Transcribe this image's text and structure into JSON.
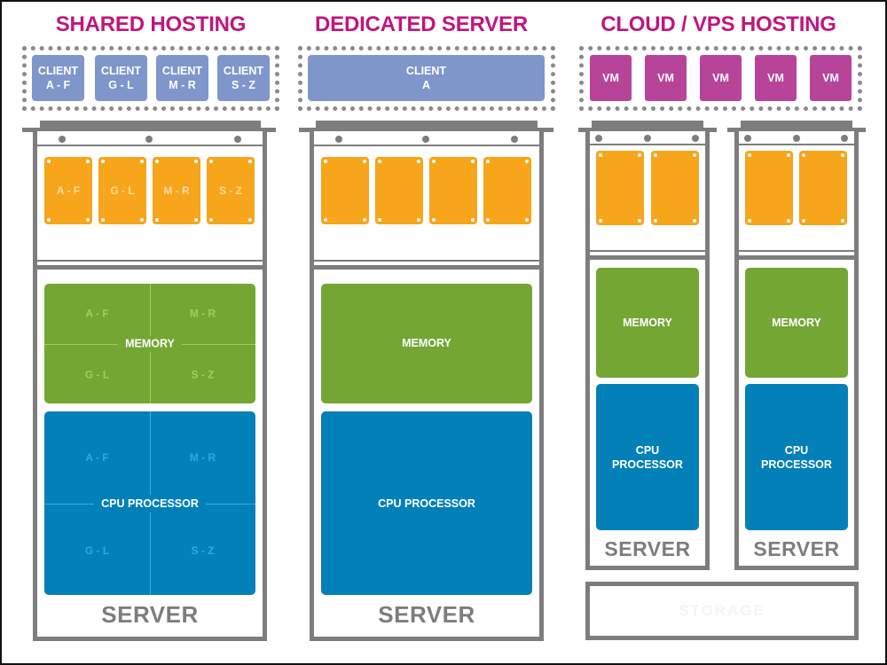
{
  "colors": {
    "title": "#c0157f",
    "client": "#7f96cb",
    "vm": "#b8449a",
    "drive": "#f7a51b",
    "memory": "#74a634",
    "cpu": "#0480b9",
    "chassis": "#7d7d7d"
  },
  "shared": {
    "title": "SHARED HOSTING",
    "clients": [
      {
        "line1": "CLIENT",
        "line2": "A - F"
      },
      {
        "line1": "CLIENT",
        "line2": "G - L"
      },
      {
        "line1": "CLIENT",
        "line2": "M - R"
      },
      {
        "line1": "CLIENT",
        "line2": "S - Z"
      }
    ],
    "drives": [
      "A - F",
      "G - L",
      "M - R",
      "S - Z"
    ],
    "memory": {
      "label": "MEMORY",
      "quadrants": [
        "A - F",
        "M - R",
        "G - L",
        "S - Z"
      ]
    },
    "cpu": {
      "label": "CPU PROCESSOR",
      "quadrants": [
        "A - F",
        "M - R",
        "G - L",
        "S - Z"
      ]
    },
    "server_label": "SERVER"
  },
  "dedicated": {
    "title": "DEDICATED SERVER",
    "client": {
      "line1": "CLIENT",
      "line2": "A"
    },
    "drives": [
      "",
      "",
      "",
      ""
    ],
    "memory": {
      "label": "MEMORY"
    },
    "cpu": {
      "label": "CPU PROCESSOR"
    },
    "server_label": "SERVER"
  },
  "cloud": {
    "title": "CLOUD / VPS HOSTING",
    "vms": [
      "VM",
      "VM",
      "VM",
      "VM",
      "VM"
    ],
    "servers": [
      {
        "memory": "MEMORY",
        "cpu_line1": "CPU",
        "cpu_line2": "PROCESSOR",
        "server_label": "SERVER"
      },
      {
        "memory": "MEMORY",
        "cpu_line1": "CPU",
        "cpu_line2": "PROCESSOR",
        "server_label": "SERVER"
      }
    ],
    "storage_label": "STORAGE"
  }
}
